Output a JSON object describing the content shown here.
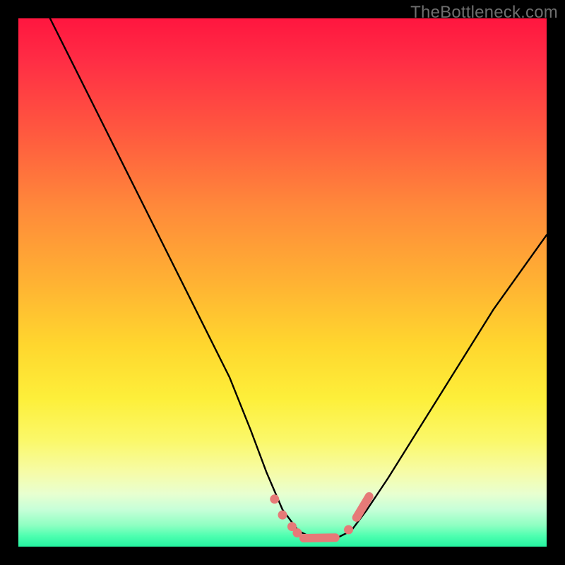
{
  "watermark": "TheBottleneck.com",
  "chart_data": {
    "type": "line",
    "title": "",
    "xlabel": "",
    "ylabel": "",
    "xlim": [
      0,
      100
    ],
    "ylim": [
      0,
      100
    ],
    "series": [
      {
        "name": "bottleneck-curve",
        "x": [
          6,
          10,
          15,
          20,
          25,
          30,
          35,
          40,
          44,
          47,
          50,
          53,
          56,
          58,
          60,
          63,
          66,
          70,
          75,
          80,
          85,
          90,
          95,
          100
        ],
        "y": [
          100,
          92,
          82,
          72,
          62,
          52,
          42,
          32,
          22,
          14,
          7,
          3,
          1.5,
          1.3,
          1.5,
          3,
          7,
          13,
          21,
          29,
          37,
          45,
          52,
          59
        ]
      }
    ],
    "markers": [
      {
        "name": "left-dot-1",
        "x": 48.5,
        "y": 9.0
      },
      {
        "name": "left-dot-2",
        "x": 50.0,
        "y": 6.0
      },
      {
        "name": "left-dot-3",
        "x": 51.8,
        "y": 3.8
      },
      {
        "name": "left-dot-4",
        "x": 52.8,
        "y": 2.6
      },
      {
        "name": "bottom-bar-left",
        "x": 54.0,
        "y": 1.6
      },
      {
        "name": "bottom-bar-right",
        "x": 60.0,
        "y": 1.7
      },
      {
        "name": "right-dot-1",
        "x": 62.5,
        "y": 3.2
      },
      {
        "name": "right-seg-a",
        "x": 64.0,
        "y": 5.5
      },
      {
        "name": "right-seg-b",
        "x": 66.4,
        "y": 9.5
      }
    ],
    "marker_color": "#e67a78",
    "curve_color": "#000000"
  }
}
